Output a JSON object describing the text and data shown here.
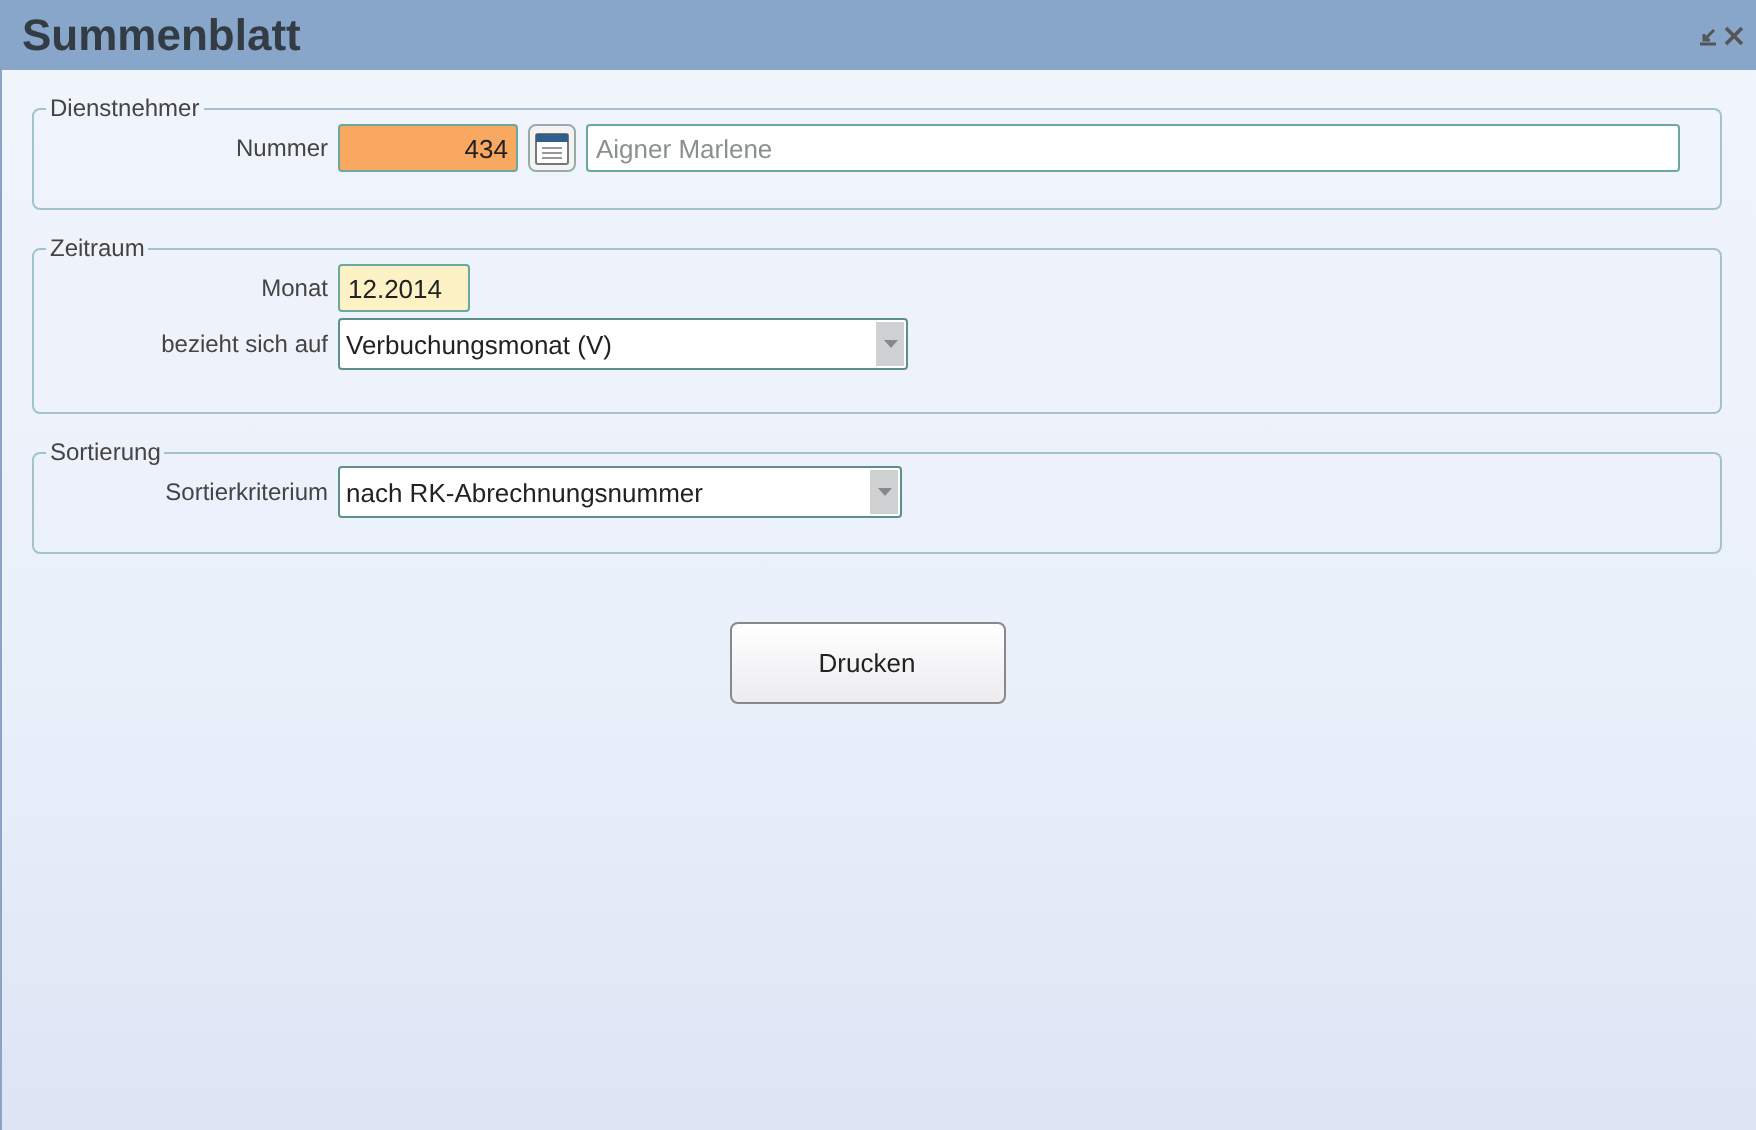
{
  "window": {
    "title": "Summenblatt"
  },
  "sections": [
    {
      "legend": "Dienstnehmer",
      "rows": [
        {
          "label": "Nummer",
          "fields": [
            {
              "kind": "number",
              "value": "434"
            },
            {
              "kind": "lookup"
            },
            {
              "kind": "text",
              "value": "Aigner Marlene"
            }
          ]
        }
      ]
    },
    {
      "legend": "Zeitraum",
      "rows": [
        {
          "label": "Monat",
          "fields": [
            {
              "kind": "month",
              "value": "12.2014"
            }
          ]
        },
        {
          "label": "bezieht sich auf",
          "fields": [
            {
              "kind": "select",
              "value": "Verbuchungsmonat (V)"
            }
          ]
        }
      ]
    },
    {
      "legend": "Sortierung",
      "rows": [
        {
          "label": "Sortierkriterium",
          "fields": [
            {
              "kind": "select",
              "value": "nach RK-Abrechnungsnummer"
            }
          ]
        }
      ]
    }
  ],
  "buttons": [
    "Drucken"
  ]
}
